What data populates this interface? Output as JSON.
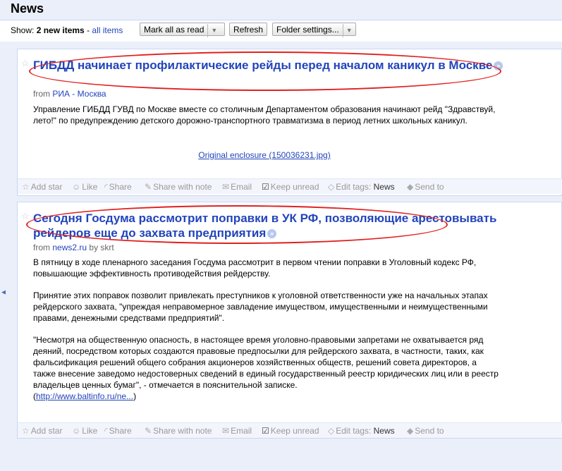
{
  "header": {
    "title": "News"
  },
  "toolbar": {
    "show_label": "Show:",
    "new_items": "2 new items",
    "separator": "-",
    "all_items": "all items",
    "mark_all_read": "Mark all as read",
    "refresh": "Refresh",
    "folder_settings": "Folder settings..."
  },
  "entries": [
    {
      "title": "ГИБДД начинает профилактические рейды перед началом каникул в Москве",
      "from_label": "from",
      "source": "РИА - Москва",
      "author": "",
      "paragraphs": [
        "Управление ГИБДД ГУВД по Москве вместе со столичным Департаментом образования начинают рейд \"Здравствуй, лето!\" по предупреждению детского дорожно-транспортного травматизма в период летних школьных каникул."
      ],
      "enclosure": "Original enclosure (150036231.jpg)",
      "link": ""
    },
    {
      "title": "Сегодня Госдума рассмотрит поправки в УК РФ, позволяющие арестовывать рейдеров еще до захвата предприятия",
      "from_label": "from",
      "source": "news2.ru",
      "author": "by skrt",
      "paragraphs": [
        "В пятницу в ходе пленарного заседания Госдума рассмотрит в первом чтении поправки в Уголовный кодекс РФ, повышающие эффективность противодействия рейдерству.",
        "Принятие этих поправок позволит привлекать преступников к уголовной ответственности уже на начальных этапах рейдерского захвата, \"упреждая неправомерное завладение имуществом, имущественными и неимущественными правами, денежными средствами предприятий\".",
        "\"Несмотря на общественную опасность, в настоящее время уголовно-правовыми запретами не охватывается ряд деяний, посредством которых создаются правовые предпосылки для рейдерского захвата, в частности, таких, как фальсификация решений общего собрания акционеров хозяйственных обществ, решений совета директоров, а также внесение заведомо недостоверных сведений в единый государственный реестр юридических лиц или в реестр владельцев ценных бумаг\", - отмечается в пояснительной записке."
      ],
      "enclosure": "",
      "link": "http://www.baltinfo.ru/ne..."
    }
  ],
  "actions": {
    "add_star": "Add star",
    "like": "Like",
    "share": "Share",
    "share_with_note": "Share with note",
    "email": "Email",
    "keep_unread": "Keep unread",
    "edit_tags": "Edit tags:",
    "tag": "News",
    "send_to": "Send to"
  },
  "icons": [
    "star-icon",
    "like-icon",
    "share-icon",
    "share-note-icon",
    "email-icon",
    "checkbox-icon",
    "tag-icon",
    "send-icon",
    "go-arrow-icon",
    "dropdown-arrow-icon"
  ],
  "colors": {
    "accent": "#2244bb",
    "header_bg": "#ebeff9",
    "annotation": "#e02020"
  }
}
